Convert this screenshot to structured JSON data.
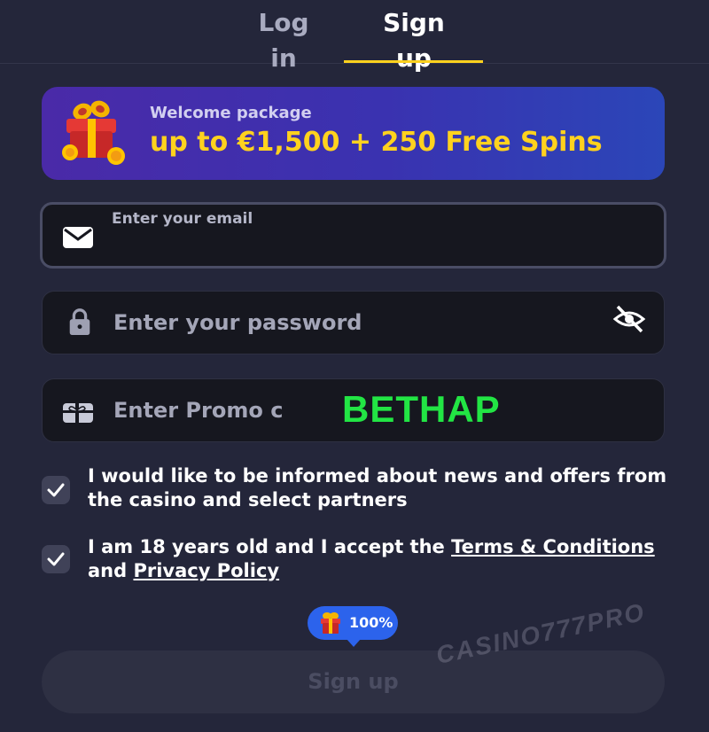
{
  "tabs": {
    "login": "Log in",
    "signup": "Sign up",
    "active": "signup"
  },
  "banner": {
    "subtitle": "Welcome package",
    "title": "up to €1,500 + 250 Free Spins",
    "accent_color": "#ffd21e"
  },
  "email": {
    "label": "Enter your email",
    "value": "",
    "icon": "envelope-icon"
  },
  "password": {
    "placeholder": "Enter your password",
    "icon": "lock-icon",
    "toggle_icon": "eye-off-icon"
  },
  "promo": {
    "placeholder": "Enter Promo code",
    "code": "BETHAP",
    "icon": "gift-card-icon",
    "code_color": "#22e544"
  },
  "consents": [
    {
      "checked": true,
      "text": "I would like to be informed about news and offers from the casino and select partners"
    },
    {
      "checked": true,
      "prefix": "I am 18 years old and I accept the",
      "terms_link": "Terms & Conditions",
      "middle": "and",
      "privacy_link": "Privacy Policy"
    }
  ],
  "progress_badge": {
    "icon": "gift-icon",
    "label": "100%",
    "value": 1.0
  },
  "submit": {
    "label": "Sign up"
  },
  "watermark": "CASINO777PRO"
}
